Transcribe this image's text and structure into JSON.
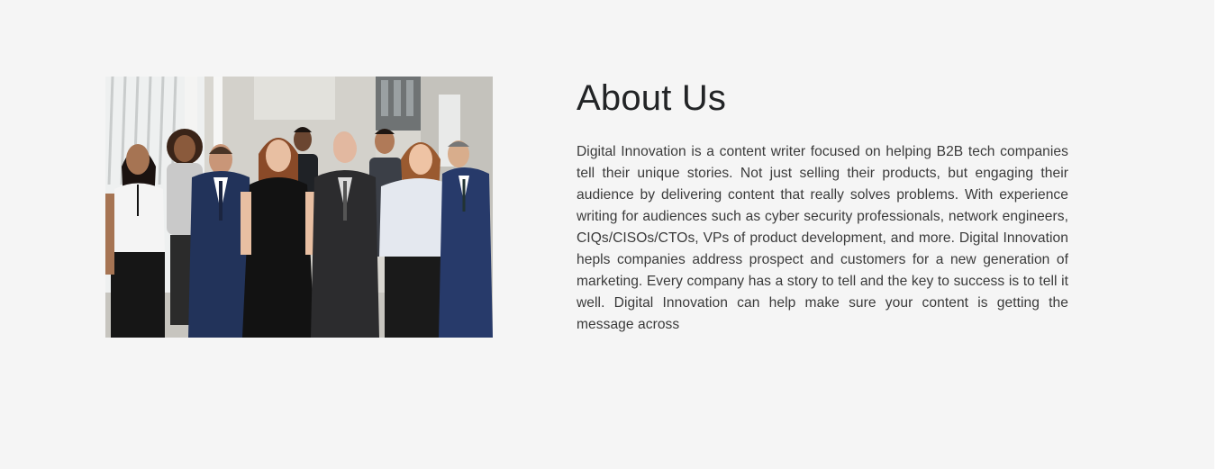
{
  "about": {
    "heading": "About Us",
    "body": "Digital Innovation is a content writer focused on helping B2B tech companies tell their unique stories. Not just selling their products, but engaging their audience by delivering content that really solves problems. With experience writing for audiences such as cyber security professionals, network engineers, CIQs/CISOs/CTOs, VPs of product development, and more. Digital Innovation hepls companies address prospect and customers for a new generation of marketing. Every company has a story to tell and the key to success is to tell it well. Digital Innovation can help make sure your content is getting the message across"
  },
  "photo": {
    "icon": "team-photo"
  },
  "colors": {
    "background": "#f5f5f5",
    "heading": "#222426",
    "body_text": "#3a3a3a"
  }
}
